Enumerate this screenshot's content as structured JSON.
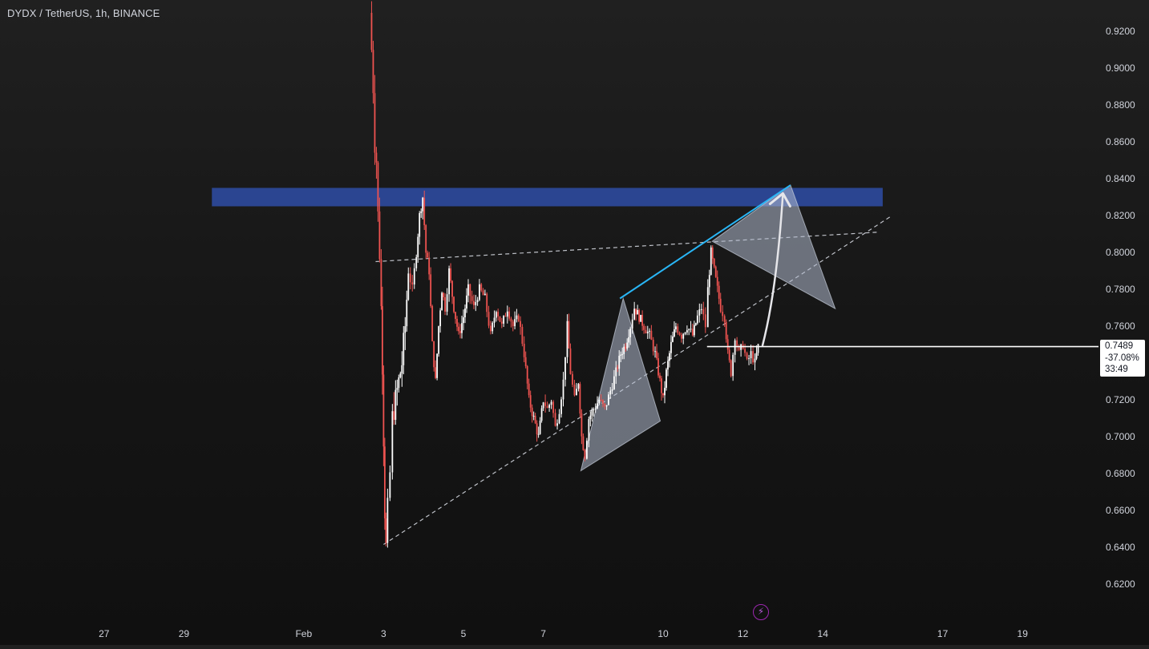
{
  "header": {
    "title": "DYDX / TetherUS, 1h, BINANCE"
  },
  "price_badge": {
    "price": "0.7489",
    "change": "-37.08%",
    "countdown": "33:49"
  },
  "colors": {
    "up_candle": "#ffffff",
    "down_candle": "#ef5350",
    "resistance_zone": "#2e4a9e",
    "channel_line": "#29b6f6",
    "dashed_line": "#d1d4dc",
    "pattern_fill": "#b2bccf",
    "axis_text": "#d1d4dc"
  },
  "icons": {
    "bottom_center": "lightning-bolt-icon"
  },
  "chart_data": {
    "type": "candlestick",
    "symbol": "DYDX / TetherUS",
    "interval": "1h",
    "exchange": "BINANCE",
    "last_price": 0.7489,
    "change_pct": -37.08,
    "ylim": [
      0.6,
      0.93
    ],
    "y_ticks": [
      0.62,
      0.64,
      0.66,
      0.68,
      0.7,
      0.72,
      0.74,
      0.76,
      0.78,
      0.8,
      0.82,
      0.84,
      0.86,
      0.88,
      0.9,
      0.92
    ],
    "y_tick_labels": [
      "0.6200",
      "0.6400",
      "0.6600",
      "0.6800",
      "0.7000",
      "0.7200",
      "0.7400",
      "0.7600",
      "0.7800",
      "0.8000",
      "0.8200",
      "0.8400",
      "0.8600",
      "0.8800",
      "0.9000",
      "0.9200"
    ],
    "x_range_days": [
      25.5,
      46
    ],
    "x_ticks": [
      {
        "day": 27,
        "label": "27"
      },
      {
        "day": 29,
        "label": "29"
      },
      {
        "day": 32,
        "label": "Feb"
      },
      {
        "day": 34,
        "label": "3"
      },
      {
        "day": 36,
        "label": "5"
      },
      {
        "day": 38,
        "label": "7"
      },
      {
        "day": 41,
        "label": "10"
      },
      {
        "day": 43,
        "label": "12"
      },
      {
        "day": 45,
        "label": "14"
      },
      {
        "day": 48,
        "label": "17"
      },
      {
        "day": 50,
        "label": "19"
      }
    ],
    "candle_path": [
      [
        33.68,
        0.93
      ],
      [
        33.7,
        0.91
      ],
      [
        33.74,
        0.89
      ],
      [
        33.78,
        0.86
      ],
      [
        33.82,
        0.85
      ],
      [
        33.86,
        0.82
      ],
      [
        33.9,
        0.8
      ],
      [
        33.94,
        0.77
      ],
      [
        33.97,
        0.74
      ],
      [
        34.0,
        0.7
      ],
      [
        34.03,
        0.66
      ],
      [
        34.06,
        0.64
      ],
      [
        34.1,
        0.66
      ],
      [
        34.16,
        0.68
      ],
      [
        34.22,
        0.71
      ],
      [
        34.3,
        0.72
      ],
      [
        34.38,
        0.73
      ],
      [
        34.46,
        0.74
      ],
      [
        34.54,
        0.76
      ],
      [
        34.62,
        0.79
      ],
      [
        34.72,
        0.78
      ],
      [
        34.82,
        0.8
      ],
      [
        34.9,
        0.82
      ],
      [
        34.98,
        0.83
      ],
      [
        35.06,
        0.8
      ],
      [
        35.14,
        0.79
      ],
      [
        35.22,
        0.75
      ],
      [
        35.3,
        0.73
      ],
      [
        35.38,
        0.76
      ],
      [
        35.46,
        0.78
      ],
      [
        35.54,
        0.77
      ],
      [
        35.64,
        0.79
      ],
      [
        35.76,
        0.77
      ],
      [
        35.88,
        0.755
      ],
      [
        36.0,
        0.765
      ],
      [
        36.12,
        0.78
      ],
      [
        36.26,
        0.77
      ],
      [
        36.4,
        0.78
      ],
      [
        36.54,
        0.775
      ],
      [
        36.68,
        0.755
      ],
      [
        36.82,
        0.77
      ],
      [
        36.96,
        0.76
      ],
      [
        37.1,
        0.77
      ],
      [
        37.24,
        0.76
      ],
      [
        37.38,
        0.765
      ],
      [
        37.52,
        0.745
      ],
      [
        37.64,
        0.72
      ],
      [
        37.76,
        0.71
      ],
      [
        37.88,
        0.7
      ],
      [
        38.0,
        0.72
      ],
      [
        38.1,
        0.715
      ],
      [
        38.2,
        0.72
      ],
      [
        38.3,
        0.705
      ],
      [
        38.4,
        0.715
      ],
      [
        38.5,
        0.73
      ],
      [
        38.6,
        0.76
      ],
      [
        38.68,
        0.735
      ],
      [
        38.78,
        0.72
      ],
      [
        38.88,
        0.73
      ],
      [
        38.96,
        0.7
      ],
      [
        39.04,
        0.69
      ],
      [
        39.14,
        0.71
      ],
      [
        39.26,
        0.715
      ],
      [
        39.4,
        0.72
      ],
      [
        39.54,
        0.715
      ],
      [
        39.68,
        0.725
      ],
      [
        39.82,
        0.735
      ],
      [
        39.94,
        0.745
      ],
      [
        40.06,
        0.75
      ],
      [
        40.18,
        0.76
      ],
      [
        40.28,
        0.77
      ],
      [
        40.4,
        0.765
      ],
      [
        40.52,
        0.76
      ],
      [
        40.66,
        0.755
      ],
      [
        40.8,
        0.745
      ],
      [
        40.92,
        0.73
      ],
      [
        41.0,
        0.72
      ],
      [
        41.08,
        0.735
      ],
      [
        41.2,
        0.75
      ],
      [
        41.32,
        0.76
      ],
      [
        41.46,
        0.755
      ],
      [
        41.6,
        0.76
      ],
      [
        41.74,
        0.755
      ],
      [
        41.86,
        0.765
      ],
      [
        41.96,
        0.77
      ],
      [
        42.06,
        0.76
      ],
      [
        42.12,
        0.78
      ],
      [
        42.2,
        0.8
      ],
      [
        42.28,
        0.79
      ],
      [
        42.36,
        0.78
      ],
      [
        42.44,
        0.77
      ],
      [
        42.54,
        0.765
      ],
      [
        42.62,
        0.745
      ],
      [
        42.7,
        0.735
      ],
      [
        42.8,
        0.755
      ],
      [
        42.9,
        0.745
      ],
      [
        43.0,
        0.75
      ],
      [
        43.1,
        0.74
      ],
      [
        43.2,
        0.745
      ],
      [
        43.3,
        0.74
      ],
      [
        43.38,
        0.7489
      ]
    ],
    "overlays": {
      "resistance_zone": {
        "day_start": 29.7,
        "day_end": 46.5,
        "price_low": 0.825,
        "price_high": 0.835
      },
      "rising_support_dashed": {
        "from": [
          34.0,
          0.6415
        ],
        "to": [
          46.7,
          0.8195
        ]
      },
      "upper_dashed": {
        "from": [
          33.8,
          0.795
        ],
        "to": [
          46.4,
          0.811
        ]
      },
      "channel_line": {
        "from": [
          39.92,
          0.775
        ],
        "to": [
          44.19,
          0.8365
        ]
      },
      "last_price_line": {
        "from": [
          42.1,
          0.7489
        ],
        "to": [
          46.0,
          0.7489
        ]
      },
      "pattern_left": [
        [
          38.94,
          0.6815
        ],
        [
          40.0,
          0.775
        ],
        [
          40.93,
          0.7085
        ]
      ],
      "pattern_right": [
        [
          42.23,
          0.806
        ],
        [
          44.19,
          0.8365
        ],
        [
          45.31,
          0.7695
        ]
      ],
      "arrow": {
        "from": [
          43.49,
          0.7495
        ],
        "to": [
          44.0,
          0.832
        ]
      }
    }
  }
}
